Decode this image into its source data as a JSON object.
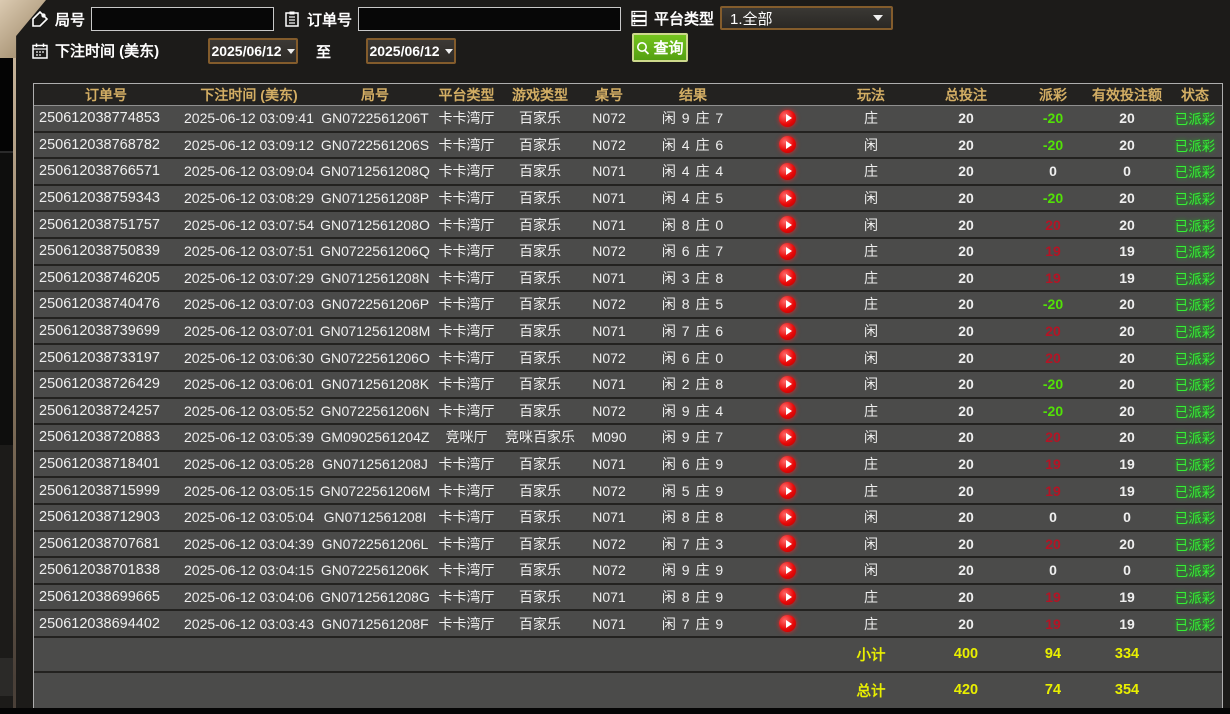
{
  "filters": {
    "game_no_label": "局号",
    "game_no_value": "",
    "order_no_label": "订单号",
    "order_no_value": "",
    "platform_label": "平台类型",
    "platform_selected": "1.全部",
    "bet_time_label": "下注时间 (美东)",
    "date_from": "2025/06/12",
    "to_label": "至",
    "date_to": "2025/06/12",
    "query_label": "查询"
  },
  "colors": {
    "header_gold": "#d3ae64",
    "win_red": "#b41425",
    "loss_green": "#52e206",
    "status_green": "#35ef35",
    "total_yellow": "#e9ef00",
    "button_green": "#5fae17",
    "picker_border_brown": "#835c2c"
  },
  "table": {
    "headers": [
      "订单号",
      "下注时间 (美东)",
      "局号",
      "平台类型",
      "游戏类型",
      "桌号",
      "结果",
      "",
      "玩法",
      "总投注",
      "派彩",
      "有效投注额",
      "状态"
    ],
    "rows": [
      {
        "order": "250612038774853",
        "time": "2025-06-12 03:09:41",
        "game": "GN0722561206T",
        "platform": "卡卡湾厅",
        "game_type": "百家乐",
        "table_no": "N072",
        "result": "闲 9 庄 7",
        "bet_side": "庄",
        "total_bet": "20",
        "payout": "-20",
        "valid_bet": "20",
        "status": "已派彩"
      },
      {
        "order": "250612038768782",
        "time": "2025-06-12 03:09:12",
        "game": "GN0722561206S",
        "platform": "卡卡湾厅",
        "game_type": "百家乐",
        "table_no": "N072",
        "result": "闲 4 庄 6",
        "bet_side": "闲",
        "total_bet": "20",
        "payout": "-20",
        "valid_bet": "20",
        "status": "已派彩"
      },
      {
        "order": "250612038766571",
        "time": "2025-06-12 03:09:04",
        "game": "GN0712561208Q",
        "platform": "卡卡湾厅",
        "game_type": "百家乐",
        "table_no": "N071",
        "result": "闲 4 庄 4",
        "bet_side": "庄",
        "total_bet": "20",
        "payout": "0",
        "valid_bet": "0",
        "status": "已派彩"
      },
      {
        "order": "250612038759343",
        "time": "2025-06-12 03:08:29",
        "game": "GN0712561208P",
        "platform": "卡卡湾厅",
        "game_type": "百家乐",
        "table_no": "N071",
        "result": "闲 4 庄 5",
        "bet_side": "闲",
        "total_bet": "20",
        "payout": "-20",
        "valid_bet": "20",
        "status": "已派彩"
      },
      {
        "order": "250612038751757",
        "time": "2025-06-12 03:07:54",
        "game": "GN0712561208O",
        "platform": "卡卡湾厅",
        "game_type": "百家乐",
        "table_no": "N071",
        "result": "闲 8 庄 0",
        "bet_side": "闲",
        "total_bet": "20",
        "payout": "20",
        "valid_bet": "20",
        "status": "已派彩"
      },
      {
        "order": "250612038750839",
        "time": "2025-06-12 03:07:51",
        "game": "GN0722561206Q",
        "platform": "卡卡湾厅",
        "game_type": "百家乐",
        "table_no": "N072",
        "result": "闲 6 庄 7",
        "bet_side": "庄",
        "total_bet": "20",
        "payout": "19",
        "valid_bet": "19",
        "status": "已派彩"
      },
      {
        "order": "250612038746205",
        "time": "2025-06-12 03:07:29",
        "game": "GN0712561208N",
        "platform": "卡卡湾厅",
        "game_type": "百家乐",
        "table_no": "N071",
        "result": "闲 3 庄 8",
        "bet_side": "庄",
        "total_bet": "20",
        "payout": "19",
        "valid_bet": "19",
        "status": "已派彩"
      },
      {
        "order": "250612038740476",
        "time": "2025-06-12 03:07:03",
        "game": "GN0722561206P",
        "platform": "卡卡湾厅",
        "game_type": "百家乐",
        "table_no": "N072",
        "result": "闲 8 庄 5",
        "bet_side": "庄",
        "total_bet": "20",
        "payout": "-20",
        "valid_bet": "20",
        "status": "已派彩"
      },
      {
        "order": "250612038739699",
        "time": "2025-06-12 03:07:01",
        "game": "GN0712561208M",
        "platform": "卡卡湾厅",
        "game_type": "百家乐",
        "table_no": "N071",
        "result": "闲 7 庄 6",
        "bet_side": "闲",
        "total_bet": "20",
        "payout": "20",
        "valid_bet": "20",
        "status": "已派彩"
      },
      {
        "order": "250612038733197",
        "time": "2025-06-12 03:06:30",
        "game": "GN0722561206O",
        "platform": "卡卡湾厅",
        "game_type": "百家乐",
        "table_no": "N072",
        "result": "闲 6 庄 0",
        "bet_side": "闲",
        "total_bet": "20",
        "payout": "20",
        "valid_bet": "20",
        "status": "已派彩"
      },
      {
        "order": "250612038726429",
        "time": "2025-06-12 03:06:01",
        "game": "GN0712561208K",
        "platform": "卡卡湾厅",
        "game_type": "百家乐",
        "table_no": "N071",
        "result": "闲 2 庄 8",
        "bet_side": "闲",
        "total_bet": "20",
        "payout": "-20",
        "valid_bet": "20",
        "status": "已派彩"
      },
      {
        "order": "250612038724257",
        "time": "2025-06-12 03:05:52",
        "game": "GN0722561206N",
        "platform": "卡卡湾厅",
        "game_type": "百家乐",
        "table_no": "N072",
        "result": "闲 9 庄 4",
        "bet_side": "庄",
        "total_bet": "20",
        "payout": "-20",
        "valid_bet": "20",
        "status": "已派彩"
      },
      {
        "order": "250612038720883",
        "time": "2025-06-12 03:05:39",
        "game": "GM0902561204Z",
        "platform": "竞咪厅",
        "game_type": "竞咪百家乐",
        "table_no": "M090",
        "result": "闲 9 庄 7",
        "bet_side": "闲",
        "total_bet": "20",
        "payout": "20",
        "valid_bet": "20",
        "status": "已派彩"
      },
      {
        "order": "250612038718401",
        "time": "2025-06-12 03:05:28",
        "game": "GN0712561208J",
        "platform": "卡卡湾厅",
        "game_type": "百家乐",
        "table_no": "N071",
        "result": "闲 6 庄 9",
        "bet_side": "庄",
        "total_bet": "20",
        "payout": "19",
        "valid_bet": "19",
        "status": "已派彩"
      },
      {
        "order": "250612038715999",
        "time": "2025-06-12 03:05:15",
        "game": "GN0722561206M",
        "platform": "卡卡湾厅",
        "game_type": "百家乐",
        "table_no": "N072",
        "result": "闲 5 庄 9",
        "bet_side": "庄",
        "total_bet": "20",
        "payout": "19",
        "valid_bet": "19",
        "status": "已派彩"
      },
      {
        "order": "250612038712903",
        "time": "2025-06-12 03:05:04",
        "game": "GN0712561208I",
        "platform": "卡卡湾厅",
        "game_type": "百家乐",
        "table_no": "N071",
        "result": "闲 8 庄 8",
        "bet_side": "闲",
        "total_bet": "20",
        "payout": "0",
        "valid_bet": "0",
        "status": "已派彩"
      },
      {
        "order": "250612038707681",
        "time": "2025-06-12 03:04:39",
        "game": "GN0722561206L",
        "platform": "卡卡湾厅",
        "game_type": "百家乐",
        "table_no": "N072",
        "result": "闲 7 庄 3",
        "bet_side": "闲",
        "total_bet": "20",
        "payout": "20",
        "valid_bet": "20",
        "status": "已派彩"
      },
      {
        "order": "250612038701838",
        "time": "2025-06-12 03:04:15",
        "game": "GN0722561206K",
        "platform": "卡卡湾厅",
        "game_type": "百家乐",
        "table_no": "N072",
        "result": "闲 9 庄 9",
        "bet_side": "闲",
        "total_bet": "20",
        "payout": "0",
        "valid_bet": "0",
        "status": "已派彩"
      },
      {
        "order": "250612038699665",
        "time": "2025-06-12 03:04:06",
        "game": "GN0712561208G",
        "platform": "卡卡湾厅",
        "game_type": "百家乐",
        "table_no": "N071",
        "result": "闲 8 庄 9",
        "bet_side": "庄",
        "total_bet": "20",
        "payout": "19",
        "valid_bet": "19",
        "status": "已派彩"
      },
      {
        "order": "250612038694402",
        "time": "2025-06-12 03:03:43",
        "game": "GN0712561208F",
        "platform": "卡卡湾厅",
        "game_type": "百家乐",
        "table_no": "N071",
        "result": "闲 7 庄 9",
        "bet_side": "庄",
        "total_bet": "20",
        "payout": "19",
        "valid_bet": "19",
        "status": "已派彩"
      }
    ],
    "subtotal": {
      "label": "小计",
      "total_bet": "400",
      "payout": "94",
      "valid_bet": "334"
    },
    "grand_total": {
      "label": "总计",
      "total_bet": "420",
      "payout": "74",
      "valid_bet": "354"
    }
  }
}
